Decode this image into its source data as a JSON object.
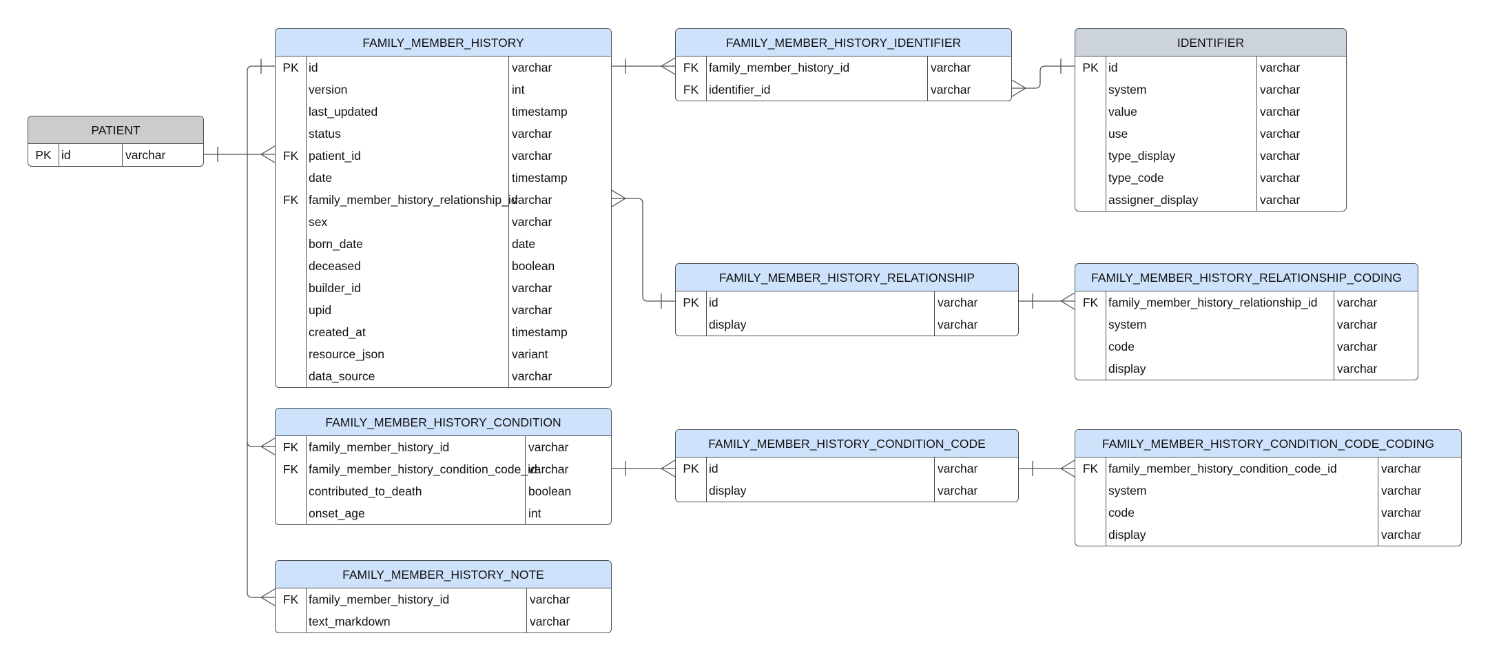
{
  "diagram": {
    "type": "entity-relationship",
    "colors": {
      "primary_header": "#cfe2fb",
      "external_header": "#cccccc",
      "identifier_header": "#cdd3db",
      "border": "#4a5059"
    }
  },
  "entities": {
    "patient": {
      "title": "PATIENT",
      "columns": [
        {
          "key": "PK",
          "name": "id",
          "type": "varchar"
        }
      ]
    },
    "fmh": {
      "title": "FAMILY_MEMBER_HISTORY",
      "columns": [
        {
          "key": "PK",
          "name": "id",
          "type": "varchar"
        },
        {
          "key": "",
          "name": "version",
          "type": "int"
        },
        {
          "key": "",
          "name": "last_updated",
          "type": "timestamp"
        },
        {
          "key": "",
          "name": "status",
          "type": "varchar"
        },
        {
          "key": "FK",
          "name": "patient_id",
          "type": "varchar"
        },
        {
          "key": "",
          "name": "date",
          "type": "timestamp"
        },
        {
          "key": "FK",
          "name": "family_member_history_relationship_id",
          "type": "varchar"
        },
        {
          "key": "",
          "name": "sex",
          "type": "varchar"
        },
        {
          "key": "",
          "name": "born_date",
          "type": "date"
        },
        {
          "key": "",
          "name": "deceased",
          "type": "boolean"
        },
        {
          "key": "",
          "name": "builder_id",
          "type": "varchar"
        },
        {
          "key": "",
          "name": "upid",
          "type": "varchar"
        },
        {
          "key": "",
          "name": "created_at",
          "type": "timestamp"
        },
        {
          "key": "",
          "name": "resource_json",
          "type": "variant"
        },
        {
          "key": "",
          "name": "data_source",
          "type": "varchar"
        }
      ]
    },
    "fmh_identifier": {
      "title": "FAMILY_MEMBER_HISTORY_IDENTIFIER",
      "columns": [
        {
          "key": "FK",
          "name": "family_member_history_id",
          "type": "varchar"
        },
        {
          "key": "FK",
          "name": "identifier_id",
          "type": "varchar"
        }
      ]
    },
    "identifier": {
      "title": "IDENTIFIER",
      "columns": [
        {
          "key": "PK",
          "name": "id",
          "type": "varchar"
        },
        {
          "key": "",
          "name": "system",
          "type": "varchar"
        },
        {
          "key": "",
          "name": "value",
          "type": "varchar"
        },
        {
          "key": "",
          "name": "use",
          "type": "varchar"
        },
        {
          "key": "",
          "name": "type_display",
          "type": "varchar"
        },
        {
          "key": "",
          "name": "type_code",
          "type": "varchar"
        },
        {
          "key": "",
          "name": "assigner_display",
          "type": "varchar"
        }
      ]
    },
    "fmh_relationship": {
      "title": "FAMILY_MEMBER_HISTORY_RELATIONSHIP",
      "columns": [
        {
          "key": "PK",
          "name": "id",
          "type": "varchar"
        },
        {
          "key": "",
          "name": "display",
          "type": "varchar"
        }
      ]
    },
    "fmh_relationship_coding": {
      "title": "FAMILY_MEMBER_HISTORY_RELATIONSHIP_CODING",
      "columns": [
        {
          "key": "FK",
          "name": "family_member_history_relationship_id",
          "type": "varchar"
        },
        {
          "key": "",
          "name": "system",
          "type": "varchar"
        },
        {
          "key": "",
          "name": "code",
          "type": "varchar"
        },
        {
          "key": "",
          "name": "display",
          "type": "varchar"
        }
      ]
    },
    "fmh_condition": {
      "title": "FAMILY_MEMBER_HISTORY_CONDITION",
      "columns": [
        {
          "key": "FK",
          "name": "family_member_history_id",
          "type": "varchar"
        },
        {
          "key": "FK",
          "name": "family_member_history_condition_code_id",
          "type": "varchar"
        },
        {
          "key": "",
          "name": "contributed_to_death",
          "type": "boolean"
        },
        {
          "key": "",
          "name": "onset_age",
          "type": "int"
        }
      ]
    },
    "fmh_condition_code": {
      "title": "FAMILY_MEMBER_HISTORY_CONDITION_CODE",
      "columns": [
        {
          "key": "PK",
          "name": "id",
          "type": "varchar"
        },
        {
          "key": "",
          "name": "display",
          "type": "varchar"
        }
      ]
    },
    "fmh_condition_code_coding": {
      "title": "FAMILY_MEMBER_HISTORY_CONDITION_CODE_CODING",
      "columns": [
        {
          "key": "FK",
          "name": "family_member_history_condition_code_id",
          "type": "varchar"
        },
        {
          "key": "",
          "name": "system",
          "type": "varchar"
        },
        {
          "key": "",
          "name": "code",
          "type": "varchar"
        },
        {
          "key": "",
          "name": "display",
          "type": "varchar"
        }
      ]
    },
    "fmh_note": {
      "title": "FAMILY_MEMBER_HISTORY_NOTE",
      "columns": [
        {
          "key": "FK",
          "name": "family_member_history_id",
          "type": "varchar"
        },
        {
          "key": "",
          "name": "text_markdown",
          "type": "varchar"
        }
      ]
    }
  },
  "relationships": [
    {
      "from": "patient.id",
      "to": "fmh.patient_id",
      "cardinality": "one-to-many"
    },
    {
      "from": "fmh.id",
      "to": "fmh_identifier.family_member_history_id",
      "cardinality": "one-to-many"
    },
    {
      "from": "identifier.id",
      "to": "fmh_identifier.identifier_id",
      "cardinality": "one-to-many"
    },
    {
      "from": "fmh_relationship.id",
      "to": "fmh.family_member_history_relationship_id",
      "cardinality": "one-to-many"
    },
    {
      "from": "fmh_relationship.id",
      "to": "fmh_relationship_coding.family_member_history_relationship_id",
      "cardinality": "one-to-many"
    },
    {
      "from": "fmh.id",
      "to": "fmh_condition.family_member_history_id",
      "cardinality": "one-to-many"
    },
    {
      "from": "fmh_condition_code.id",
      "to": "fmh_condition.family_member_history_condition_code_id",
      "cardinality": "one-to-many"
    },
    {
      "from": "fmh_condition_code.id",
      "to": "fmh_condition_code_coding.family_member_history_condition_code_id",
      "cardinality": "one-to-many"
    },
    {
      "from": "fmh.id",
      "to": "fmh_note.family_member_history_id",
      "cardinality": "one-to-many"
    }
  ]
}
